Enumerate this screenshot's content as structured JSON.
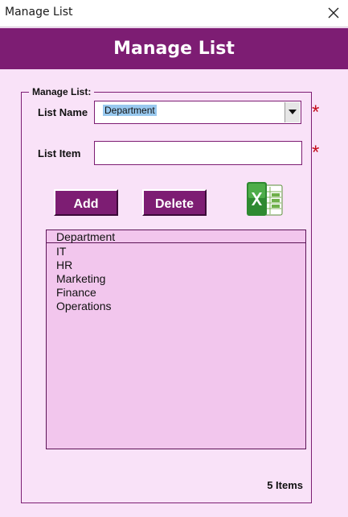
{
  "window": {
    "title": "Manage List",
    "close_icon": "close-icon"
  },
  "header": {
    "title": "Manage List",
    "band_color": "#7d1d73"
  },
  "group": {
    "legend": "Manage List:"
  },
  "form": {
    "list_name_label": "List Name",
    "list_name_value": "Department",
    "list_item_label": "List Item",
    "list_item_value": "",
    "required_mark": "*",
    "required_color": "#c40e1c"
  },
  "buttons": {
    "add": "Add",
    "delete": "Delete",
    "excel_icon": "excel-icon"
  },
  "listbox": {
    "header": "Department",
    "items": [
      "IT",
      "HR",
      "Marketing",
      "Finance",
      "Operations"
    ]
  },
  "footer": {
    "count": "5 Items"
  }
}
